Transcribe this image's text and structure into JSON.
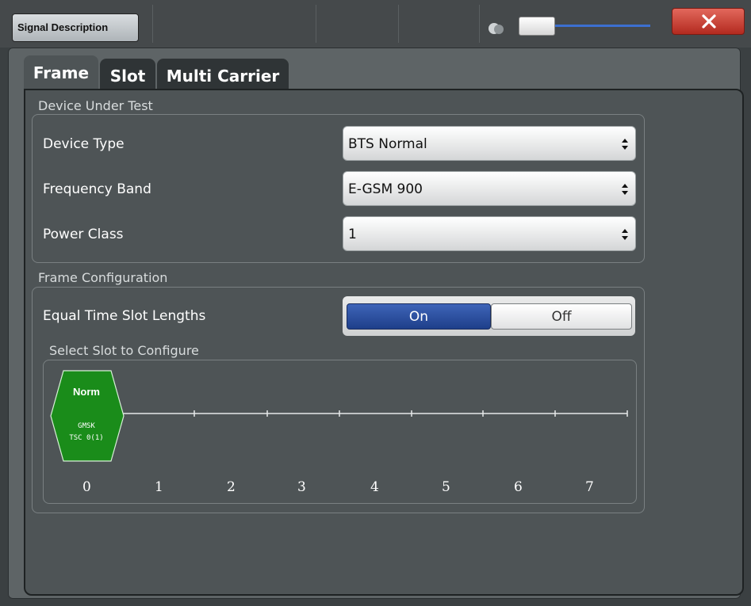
{
  "window": {
    "title": "Signal Description"
  },
  "tabs": [
    {
      "label": "Frame",
      "active": true
    },
    {
      "label": "Slot",
      "active": false
    },
    {
      "label": "Multi Carrier",
      "active": false
    }
  ],
  "device_under_test": {
    "section_label": "Device Under Test",
    "device_type": {
      "label": "Device Type",
      "value": "BTS Normal"
    },
    "frequency_band": {
      "label": "Frequency Band",
      "value": "E-GSM 900"
    },
    "power_class": {
      "label": "Power Class",
      "value": "1"
    }
  },
  "frame_configuration": {
    "section_label": "Frame Configuration",
    "equal_slot_lengths": {
      "label": "Equal Time Slot Lengths",
      "on_label": "On",
      "off_label": "Off",
      "selected": "On"
    },
    "slot_selector": {
      "label": "Select Slot to Configure",
      "active_slot": {
        "burst": "Norm",
        "modulation": "GMSK",
        "tsc": "TSC 0(1)"
      },
      "slot_numbers": [
        "0",
        "1",
        "2",
        "3",
        "4",
        "5",
        "6",
        "7"
      ]
    }
  },
  "colors": {
    "accent_blue": "#2a4fa3",
    "slot_green": "#1a8c1a",
    "close_red": "#c8392e",
    "panel_bg": "#4e5456"
  },
  "icons": [
    "close-icon",
    "toggle-icon",
    "dropdown-arrows-icon"
  ]
}
